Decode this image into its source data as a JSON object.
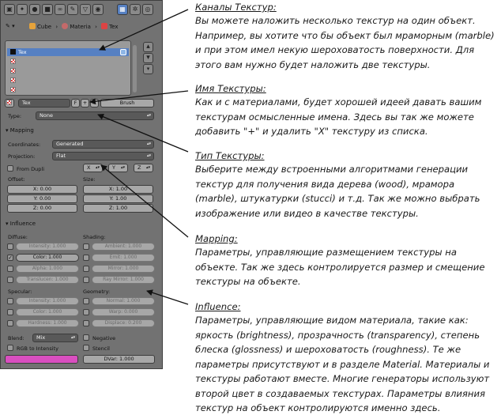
{
  "panel": {
    "toolbar_icons": [
      "render-icon",
      "scene-icon",
      "world-icon",
      "object-icon",
      "constraints-icon",
      "modifiers-icon",
      "data-icon",
      "material-icon",
      "texture-icon",
      "particles-icon",
      "physics-icon"
    ],
    "breadcrumb": {
      "object": "Cube",
      "material": "Materia",
      "texture": "Tex"
    },
    "slots": [
      "Tex",
      "",
      "",
      "",
      ""
    ],
    "texture_name": "Tex",
    "texture_fake_user": "F",
    "texture_brush": "Brush",
    "type_label": "Type:",
    "type_value": "None",
    "mapping": {
      "title": "Mapping",
      "coordinates_label": "Coordinates:",
      "coordinates_value": "Generated",
      "projection_label": "Projection:",
      "projection_value": "Flat",
      "from_dupli": "From Dupli",
      "axis": [
        "X",
        "Y",
        "Z"
      ],
      "offset_label": "Offset:",
      "offset": [
        "X: 0.00",
        "Y: 0.00",
        "Z: 0.00"
      ],
      "size_label": "Size:",
      "size": [
        "X: 1.00",
        "Y: 1.00",
        "Z: 1.00"
      ]
    },
    "influence": {
      "title": "Influence",
      "diffuse_label": "Diffuse:",
      "diffuse": [
        "Intensity: 1.000",
        "Color: 1.000",
        "Alpha: 1.000",
        "Translucen: 1.000"
      ],
      "shading_label": "Shading:",
      "shading": [
        "Ambient: 1.000",
        "Emit: 1.000",
        "Mirror: 1.000",
        "Ray Mirror: 1.000"
      ],
      "specular_label": "Specular:",
      "specular": [
        "Intensity: 1.000",
        "Color: 1.000",
        "Hardness: 1.000"
      ],
      "geometry_label": "Geometry:",
      "geometry": [
        "Normal: 1.000",
        "Warp: 0.000",
        "Displace: 0.200"
      ],
      "blend_label": "Blend:",
      "blend_value": "Mix",
      "negative": "Negative",
      "rgb_to_intensity": "RGB to Intensity",
      "stencil": "Stencil",
      "dvar": "DVar: 1.000",
      "color_swatch": "#d94fc0"
    }
  },
  "notes": [
    {
      "heading": "Каналы Текстур:",
      "lines": [
        "Вы можете наложить несколько текстур на один объект.",
        "Например, вы хотите что бы объект был мраморным (marble)",
        "и при этом имел некую шероховатость поверхности. Для",
        "этого вам нужно будет наложить две текстуры."
      ]
    },
    {
      "heading": "Имя Текстуры:",
      "lines": [
        "Как и с материалами, будет хорошей идеей давать вашим",
        "текстурам осмысленные имена. Здесь вы так же можете",
        "добавить \"+\" и удалить \"X\" текстуру из списка."
      ]
    },
    {
      "heading": "Тип Текстуры:",
      "lines": [
        "Выберите между встроенными алгоритмами генерации",
        "текстур для получения вида дерева (wood), мрамора",
        "(marble), штукатурки (stucci) и т.д. Так же можно выбрать",
        "изображение или видео в качестве текстуры."
      ]
    },
    {
      "heading": "Mapping:",
      "lines": [
        "Параметры, управляющие размещением текстуры на",
        "объекте. Так же здесь контролируется размер и смещение",
        "текстуры на объекте."
      ]
    },
    {
      "heading": "Influence:",
      "lines": [
        "Параметры, управляющие видом материала, такие как:",
        "яркость (brightness), прозрачность (transparency), степень",
        "блеска (glossness) и шероховатость (roughness). Те же",
        "параметры присутствуют и в разделе Material. Материалы и",
        "текстуры работают вместе. Многие генераторы используют",
        "второй цвет в создаваемых текстурах. Параметры влияния",
        "текстур на объект контролируются именно здесь."
      ]
    }
  ]
}
